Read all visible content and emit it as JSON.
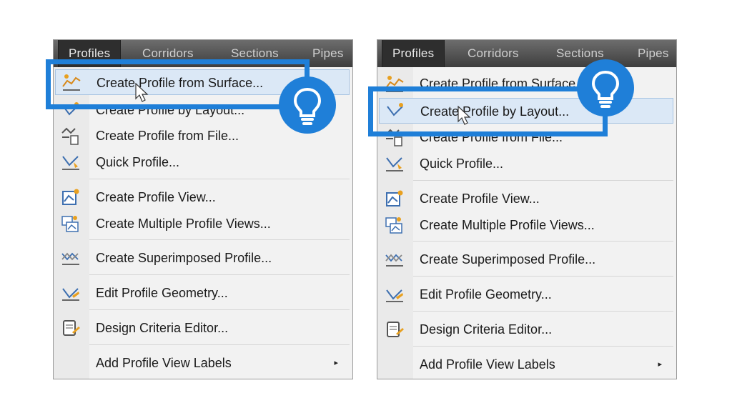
{
  "menubar": {
    "tabs": [
      "Profiles",
      "Corridors",
      "Sections",
      "Pipes"
    ]
  },
  "menu": {
    "items": [
      {
        "label": "Create Profile from Surface...",
        "icon": "profile-from-surface-icon"
      },
      {
        "label": "Create Profile by Layout...",
        "icon": "profile-by-layout-icon"
      },
      {
        "label": "Create Profile from File...",
        "icon": "profile-from-file-icon"
      },
      {
        "label": "Quick Profile...",
        "icon": "quick-profile-icon"
      },
      {
        "label": "Create Profile View...",
        "icon": "profile-view-icon"
      },
      {
        "label": "Create Multiple Profile Views...",
        "icon": "multiple-profile-views-icon"
      },
      {
        "label": "Create Superimposed Profile...",
        "icon": "superimposed-profile-icon"
      },
      {
        "label": "Edit Profile Geometry...",
        "icon": "edit-profile-geometry-icon"
      },
      {
        "label": "Design Criteria Editor...",
        "icon": "design-criteria-editor-icon"
      },
      {
        "label": "Add Profile View Labels",
        "icon": "",
        "submenu": "▸"
      }
    ]
  },
  "colors": {
    "callout": "#1f7fd8",
    "highlight": "#dbe8f6",
    "menubar": "#4a4a4a"
  }
}
